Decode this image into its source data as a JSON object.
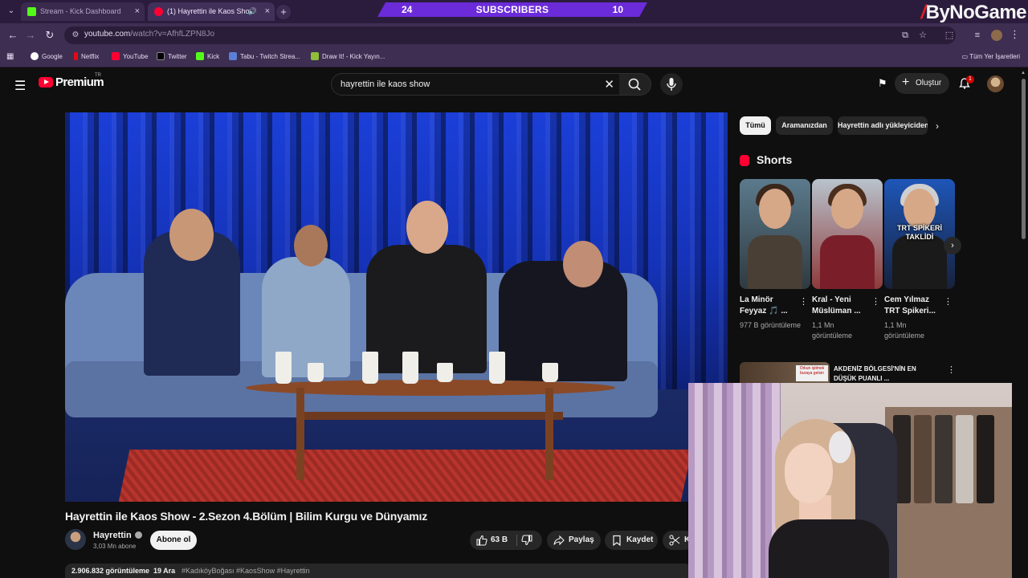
{
  "browser": {
    "tabs": [
      {
        "label": "Stream - Kick Dashboard",
        "favicon": "kick-icon"
      },
      {
        "label": "(1) Hayrettin ile Kaos Show",
        "favicon": "youtube-icon",
        "audio": true
      }
    ],
    "url_host": "youtube.com",
    "url_path": "/watch?v=AfhfLZPN8Jo",
    "bookmarks": [
      "Google",
      "Netflix",
      "YouTube",
      "Twitter",
      "Kick",
      "Tabu - Twitch Strea...",
      "Draw It! - Kick Yayın..."
    ],
    "all_bookmarks_label": "Tüm Yer İşaretleri"
  },
  "overlay": {
    "sub_left": "24",
    "sub_label": "SUBSCRIBERS",
    "sub_right": "10",
    "brand_slash": "/",
    "brand_text": "ByNoGame"
  },
  "youtube": {
    "logo_text": "Premium",
    "logo_region": "TR",
    "search_query": "hayrettin ile kaos show",
    "create_label": "Oluştur",
    "notification_count": "1",
    "video": {
      "title": "Hayrettin ile Kaos Show - 2.Sezon 4.Bölüm | Bilim Kurgu ve Dünyamız",
      "channel": "Hayrettin",
      "subscribers": "3,03 Mn abone",
      "subscribe_label": "Abone ol",
      "likes": "63 B",
      "share_label": "Paylaş",
      "save_label": "Kaydet",
      "clip_label": "Kl",
      "views": "2.906.832 görüntüleme",
      "date": "19 Ara",
      "hashtags": "#KadıköyBoğası #KaosShow #Hayrettin"
    },
    "chips": [
      "Tümü",
      "Aramanızdan",
      "Hayrettin adlı yükleyiciden"
    ],
    "shorts_heading": "Shorts",
    "shorts": [
      {
        "title": "La Minör Feyyaz 🎵 ...",
        "views": "977 B görüntüleme",
        "overlay": ""
      },
      {
        "title": "Kral - Yeni Müslüman ...",
        "views": "1,1 Mn görüntüleme",
        "overlay": ""
      },
      {
        "title": "Cem Yılmaz TRT Spikeri...",
        "views": "1,1 Mn görüntüleme",
        "overlay": "TRT SPİKERİ TAKLİDİ"
      }
    ],
    "rec": {
      "title": "AKDENİZ BÖLGESİ'NİN EN DÜŞÜK PUANLI ...",
      "thumb_caption": "Orkun işitmek buraya gelsin"
    }
  },
  "colors": {
    "overlay_purple": "#6c2bd9",
    "tabstrip": "#2b1c3d",
    "toolbar": "#3e2e52",
    "youtube_red": "#ff0033",
    "kick_green": "#53fc18"
  }
}
